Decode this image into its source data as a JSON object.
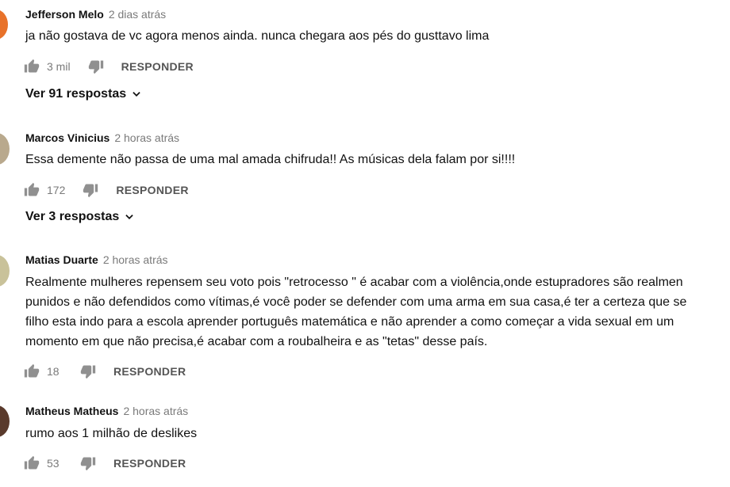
{
  "comments": [
    {
      "author": "Jefferson Melo",
      "time": "2 dias atrás",
      "lines": [
        "ja não gostava de vc agora menos ainda. nunca chegara aos pés do gusttavo lima"
      ],
      "likes": "3 mil",
      "reply_label": "RESPONDER",
      "replies_label": "Ver 91 respostas",
      "avatar_color": "#e8722a"
    },
    {
      "author": "Marcos Vinicius",
      "time": "2 horas atrás",
      "lines": [
        "Essa demente não passa de uma mal amada chifruda!! As músicas dela falam por si!!!!"
      ],
      "likes": "172",
      "reply_label": "RESPONDER",
      "replies_label": "Ver 3 respostas",
      "avatar_color": "#b9a98d"
    },
    {
      "author": "Matias Duarte",
      "time": "2 horas atrás",
      "lines": [
        "Realmente mulheres repensem seu voto pois \"retrocesso \" é acabar com a violência,onde estupradores são realmen",
        "punidos e não defendidos como vítimas,é você poder se defender com uma arma em sua casa,é ter a certeza que se",
        "filho esta indo para a escola aprender português matemática e não aprender a como começar a vida sexual em um",
        "momento em que não precisa,é acabar com a roubalheira e as \"tetas\" desse país."
      ],
      "likes": "18",
      "reply_label": "RESPONDER",
      "avatar_color": "#c9c29a"
    },
    {
      "author": "Matheus Matheus",
      "time": "2 horas atrás",
      "lines": [
        "rumo aos 1 milhão de deslikes"
      ],
      "likes": "53",
      "reply_label": "RESPONDER",
      "avatar_color": "#5a3a2c"
    }
  ]
}
